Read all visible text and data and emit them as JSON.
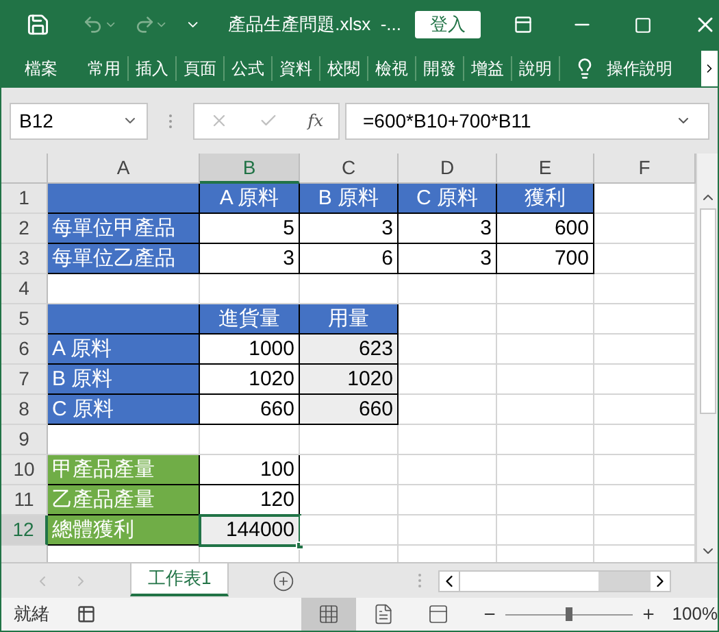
{
  "window": {
    "title": "產品生產問題.xlsx  -...",
    "sign_in": "登入"
  },
  "ribbon_tabs": [
    {
      "label": "檔案"
    },
    {
      "label": "常用"
    },
    {
      "label": "插入"
    },
    {
      "label": "頁面"
    },
    {
      "label": "公式"
    },
    {
      "label": "資料"
    },
    {
      "label": "校閱"
    },
    {
      "label": "檢視"
    },
    {
      "label": "開發"
    },
    {
      "label": "增益"
    },
    {
      "label": "說明"
    }
  ],
  "tell_me": "操作說明",
  "formula_bar": {
    "name_box": "B12",
    "function_label": "fx",
    "formula": "=600*B10+700*B11"
  },
  "sheet": {
    "columns": [
      {
        "label": "A",
        "selected": false
      },
      {
        "label": "B",
        "selected": true
      },
      {
        "label": "C",
        "selected": false
      },
      {
        "label": "D",
        "selected": false
      },
      {
        "label": "E",
        "selected": false
      },
      {
        "label": "F",
        "selected": false
      }
    ],
    "rows": [
      {
        "label": "1",
        "selected": false,
        "cells": [
          {
            "kind": "header"
          },
          {
            "kind": "header",
            "text": "A 原料"
          },
          {
            "kind": "header",
            "text": "B 原料"
          },
          {
            "kind": "header",
            "text": "C 原料"
          },
          {
            "kind": "header",
            "text": "獲利"
          },
          {
            "kind": "plain"
          }
        ]
      },
      {
        "label": "2",
        "selected": false,
        "cells": [
          {
            "kind": "label",
            "text": "每單位甲產品"
          },
          {
            "kind": "value",
            "text": "5"
          },
          {
            "kind": "value",
            "text": "3"
          },
          {
            "kind": "value",
            "text": "3"
          },
          {
            "kind": "value",
            "text": "600"
          },
          {
            "kind": "plain"
          }
        ]
      },
      {
        "label": "3",
        "selected": false,
        "cells": [
          {
            "kind": "label",
            "text": "每單位乙產品"
          },
          {
            "kind": "value",
            "text": "3"
          },
          {
            "kind": "value",
            "text": "6"
          },
          {
            "kind": "value",
            "text": "3"
          },
          {
            "kind": "value",
            "text": "700"
          },
          {
            "kind": "plain"
          }
        ]
      },
      {
        "label": "4",
        "selected": false,
        "cells": [
          {
            "kind": "plain"
          },
          {
            "kind": "plain"
          },
          {
            "kind": "plain"
          },
          {
            "kind": "plain"
          },
          {
            "kind": "plain"
          },
          {
            "kind": "plain"
          }
        ]
      },
      {
        "label": "5",
        "selected": false,
        "cells": [
          {
            "kind": "header"
          },
          {
            "kind": "header",
            "text": "進貨量"
          },
          {
            "kind": "header",
            "text": "用量"
          },
          {
            "kind": "plain"
          },
          {
            "kind": "plain"
          },
          {
            "kind": "plain"
          }
        ]
      },
      {
        "label": "6",
        "selected": false,
        "cells": [
          {
            "kind": "label",
            "text": "A 原料"
          },
          {
            "kind": "value",
            "text": "1000"
          },
          {
            "kind": "computed",
            "text": "623"
          },
          {
            "kind": "plain"
          },
          {
            "kind": "plain"
          },
          {
            "kind": "plain"
          }
        ]
      },
      {
        "label": "7",
        "selected": false,
        "cells": [
          {
            "kind": "label",
            "text": "B 原料"
          },
          {
            "kind": "value",
            "text": "1020"
          },
          {
            "kind": "computed",
            "text": "1020"
          },
          {
            "kind": "plain"
          },
          {
            "kind": "plain"
          },
          {
            "kind": "plain"
          }
        ]
      },
      {
        "label": "8",
        "selected": false,
        "cells": [
          {
            "kind": "label",
            "text": "C 原料"
          },
          {
            "kind": "value",
            "text": "660"
          },
          {
            "kind": "computed",
            "text": "660"
          },
          {
            "kind": "plain"
          },
          {
            "kind": "plain"
          },
          {
            "kind": "plain"
          }
        ]
      },
      {
        "label": "9",
        "selected": false,
        "cells": [
          {
            "kind": "plain"
          },
          {
            "kind": "plain"
          },
          {
            "kind": "plain"
          },
          {
            "kind": "plain"
          },
          {
            "kind": "plain"
          },
          {
            "kind": "plain"
          }
        ]
      },
      {
        "label": "10",
        "selected": false,
        "cells": [
          {
            "kind": "green",
            "text": "甲產品產量"
          },
          {
            "kind": "value",
            "text": "100"
          },
          {
            "kind": "plain"
          },
          {
            "kind": "plain"
          },
          {
            "kind": "plain"
          },
          {
            "kind": "plain"
          }
        ]
      },
      {
        "label": "11",
        "selected": false,
        "cells": [
          {
            "kind": "green",
            "text": "乙產品產量"
          },
          {
            "kind": "value",
            "text": "120"
          },
          {
            "kind": "plain"
          },
          {
            "kind": "plain"
          },
          {
            "kind": "plain"
          },
          {
            "kind": "plain"
          }
        ]
      },
      {
        "label": "12",
        "selected": true,
        "cells": [
          {
            "kind": "green",
            "text": "總體獲利"
          },
          {
            "kind": "computed",
            "text": "144000"
          },
          {
            "kind": "plain"
          },
          {
            "kind": "plain"
          },
          {
            "kind": "plain"
          },
          {
            "kind": "plain"
          }
        ]
      }
    ]
  },
  "sheet_tabs": [
    {
      "label": "工作表1",
      "selected": true
    }
  ],
  "status_bar": {
    "status": "就緒",
    "views": [
      {
        "kind": "normal",
        "selected": true
      },
      {
        "kind": "page_layout",
        "selected": false
      },
      {
        "kind": "page_break",
        "selected": false
      }
    ],
    "zoom": {
      "level": 0.5,
      "reading": "100%"
    }
  }
}
